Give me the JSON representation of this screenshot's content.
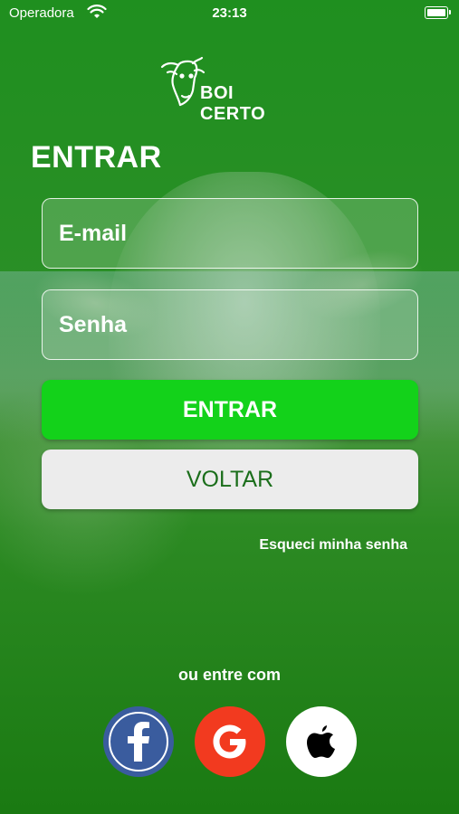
{
  "status_bar": {
    "carrier": "Operadora",
    "time": "23:13",
    "battery_level": 1.0
  },
  "logo": {
    "text": "BOI CERTO"
  },
  "title": "ENTRAR",
  "form": {
    "email_placeholder": "E-mail",
    "password_placeholder": "Senha",
    "enter_label": "ENTRAR",
    "back_label": "VOLTAR",
    "forgot_label": "Esqueci minha senha"
  },
  "social": {
    "heading": "ou entre com",
    "providers": [
      {
        "name": "facebook",
        "icon": "facebook-icon",
        "color": "#3a5c9e"
      },
      {
        "name": "google",
        "icon": "google-icon",
        "color": "#f23a1f"
      },
      {
        "name": "apple",
        "icon": "apple-icon",
        "color": "#ffffff"
      }
    ]
  },
  "colors": {
    "primary_green": "#13d21a",
    "back_text": "#1b6e1b",
    "background_green": "#2a8f26"
  }
}
